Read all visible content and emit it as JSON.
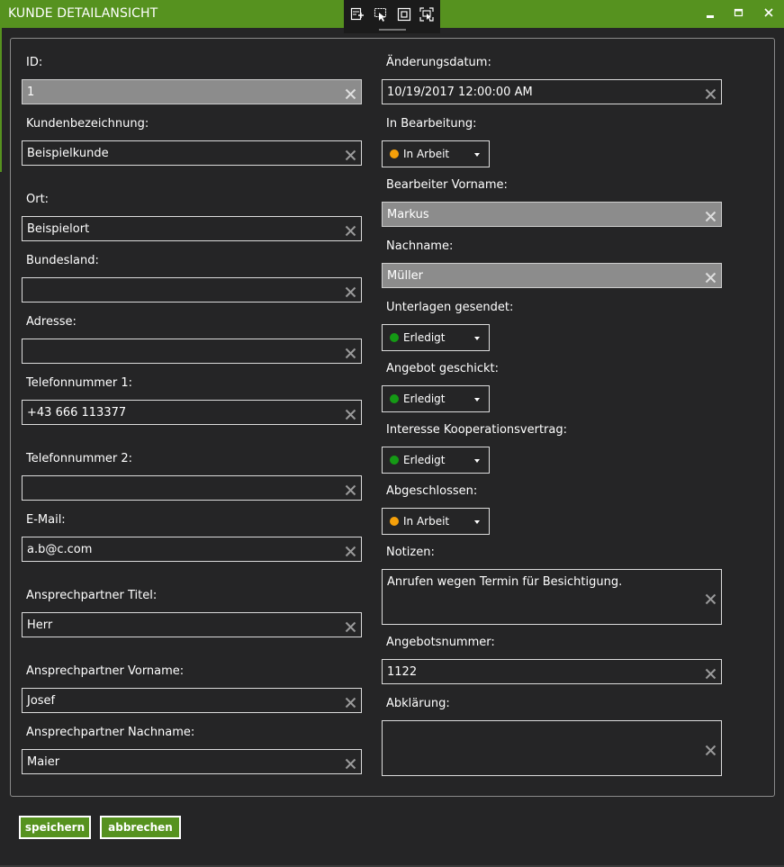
{
  "window": {
    "title": "KUNDE DETAILANSICHT",
    "accent_color": "#56921f",
    "devtools_icons": [
      "live-visual-tree-icon",
      "select-element-icon",
      "display-layout-adorners-icon",
      "track-focus-icon"
    ],
    "controls": [
      "minimize-icon",
      "maximize-icon",
      "close-icon"
    ]
  },
  "left_column": [
    {
      "label": "ID:",
      "value": "1",
      "readonly": true
    },
    {
      "label": "Kundenbezeichnung:",
      "value": "Beispielkunde",
      "readonly": false
    },
    {
      "label": "Ort:",
      "value": "Beispielort",
      "readonly": false
    },
    {
      "label": "Bundesland:",
      "value": "",
      "readonly": false
    },
    {
      "label": "Adresse:",
      "value": "",
      "readonly": false
    },
    {
      "label": "Telefonnummer 1:",
      "value": "+43 666 113377",
      "readonly": false
    },
    {
      "label": "Telefonnummer 2:",
      "value": "",
      "readonly": false
    },
    {
      "label": "E-Mail:",
      "value": "a.b@c.com",
      "readonly": false
    },
    {
      "label": "Ansprechpartner Titel:",
      "value": "Herr",
      "readonly": false
    },
    {
      "label": "Ansprechpartner Vorname:",
      "value": "Josef",
      "readonly": false
    },
    {
      "label": "Ansprechpartner Nachname:",
      "value": "Maier",
      "readonly": false
    }
  ],
  "right_column": {
    "aenderungsdatum": {
      "label": "Änderungsdatum:",
      "value": "10/19/2017 12:00:00 AM"
    },
    "in_bearbeitung": {
      "label": "In Bearbeitung:",
      "value": "In Arbeit",
      "status_color": "#f5a00a"
    },
    "bearbeiter_vorname": {
      "label": "Bearbeiter Vorname:",
      "value": "Markus",
      "readonly": true
    },
    "nachname": {
      "label": "Nachname:",
      "value": "Müller",
      "readonly": true
    },
    "unterlagen_gesendet": {
      "label": "Unterlagen gesendet:",
      "value": "Erledigt",
      "status_color": "#159a15"
    },
    "angebot_geschickt": {
      "label": "Angebot geschickt:",
      "value": "Erledigt",
      "status_color": "#159a15"
    },
    "interesse": {
      "label": "Interesse Kooperationsvertrag:",
      "value": "Erledigt",
      "status_color": "#159a15"
    },
    "abgeschlossen": {
      "label": "Abgeschlossen:",
      "value": "In Arbeit",
      "status_color": "#f5a00a"
    },
    "notizen": {
      "label": "Notizen:",
      "value": "Anrufen wegen Termin für Besichtigung."
    },
    "angebotsnummer": {
      "label": "Angebotsnummer:",
      "value": "1122"
    },
    "abklaerung": {
      "label": "Abklärung:",
      "value": ""
    }
  },
  "actions": {
    "save_label": "speichern",
    "cancel_label": "abbrechen"
  }
}
